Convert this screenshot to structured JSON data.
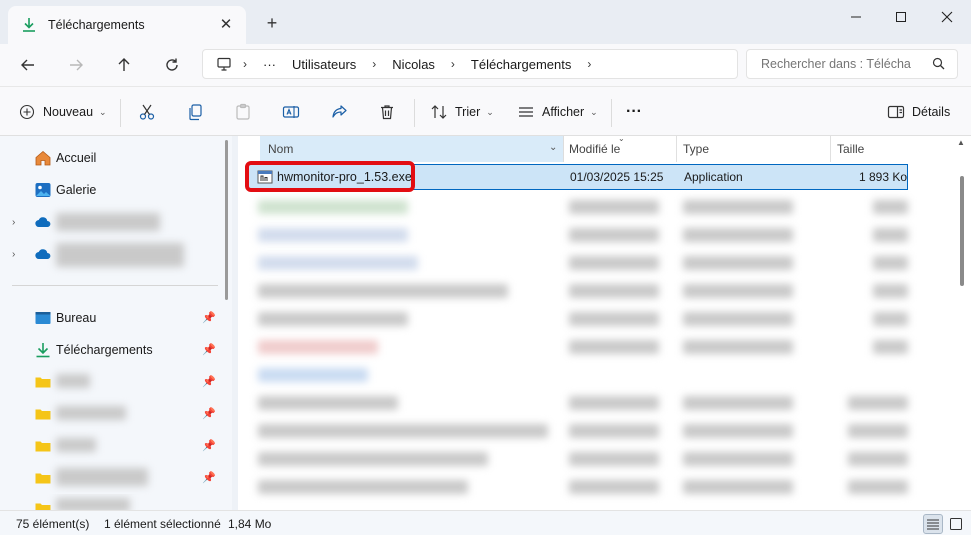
{
  "tab": {
    "title": "Téléchargements",
    "close": "✕",
    "new_tab": "+"
  },
  "window": {
    "minimize": "—",
    "maximize": "☐",
    "close": "✕"
  },
  "breadcrumb": {
    "ellipsis": "···",
    "items": [
      "Utilisateurs",
      "Nicolas",
      "Téléchargements"
    ]
  },
  "search": {
    "placeholder": "Rechercher dans : Télécha"
  },
  "toolbar": {
    "new_label": "Nouveau",
    "sort_label": "Trier",
    "view_label": "Afficher",
    "more": "···",
    "details_label": "Détails"
  },
  "sidebar": {
    "items": [
      {
        "label": "Accueil",
        "icon": "home-icon"
      },
      {
        "label": "Galerie",
        "icon": "gallery-icon"
      },
      {
        "label": "Bureau",
        "icon": "desktop-icon"
      },
      {
        "label": "Téléchargements",
        "icon": "download-icon"
      }
    ]
  },
  "columns": {
    "name": "Nom",
    "modified": "Modifié le",
    "type": "Type",
    "size": "Taille"
  },
  "selected_file": {
    "name": "hwmonitor-pro_1.53.exe",
    "modified": "01/03/2025 15:25",
    "type": "Application",
    "size": "1 893 Ko"
  },
  "status": {
    "count": "75 élément(s)",
    "selection": "1 élément sélectionné",
    "size": "1,84 Mo"
  },
  "colors": {
    "accent": "#0067c0",
    "highlight": "#e30d12",
    "download_green": "#1a9d5f"
  }
}
